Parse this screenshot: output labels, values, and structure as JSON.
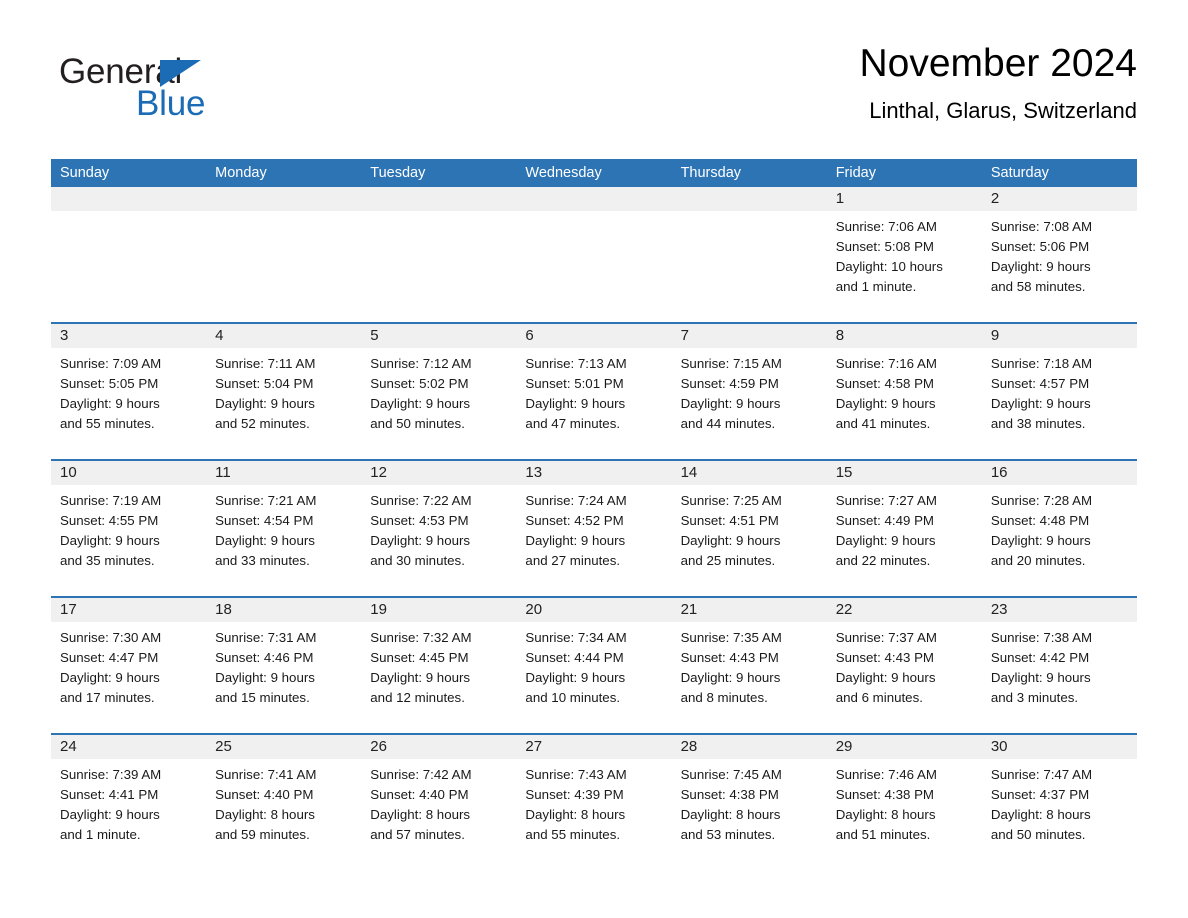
{
  "brand": {
    "name_part1": "General",
    "name_part2": "Blue",
    "logo_icon": "blue-triangle-icon",
    "accent_color": "#1b6cb5"
  },
  "header": {
    "title": "November 2024",
    "subtitle": "Linthal, Glarus, Switzerland"
  },
  "colors": {
    "header_row_bg": "#2d74b5",
    "header_row_text": "#ffffff",
    "date_band_bg": "#f0f0f0",
    "row_divider": "#2d74b5",
    "cell_text": "#1a1a1a"
  },
  "calendar": {
    "weekdays": [
      "Sunday",
      "Monday",
      "Tuesday",
      "Wednesday",
      "Thursday",
      "Friday",
      "Saturday"
    ],
    "weeks": [
      [
        {
          "date": "",
          "lines": []
        },
        {
          "date": "",
          "lines": []
        },
        {
          "date": "",
          "lines": []
        },
        {
          "date": "",
          "lines": []
        },
        {
          "date": "",
          "lines": []
        },
        {
          "date": "1",
          "lines": [
            "Sunrise: 7:06 AM",
            "Sunset: 5:08 PM",
            "Daylight: 10 hours",
            "and 1 minute."
          ]
        },
        {
          "date": "2",
          "lines": [
            "Sunrise: 7:08 AM",
            "Sunset: 5:06 PM",
            "Daylight: 9 hours",
            "and 58 minutes."
          ]
        }
      ],
      [
        {
          "date": "3",
          "lines": [
            "Sunrise: 7:09 AM",
            "Sunset: 5:05 PM",
            "Daylight: 9 hours",
            "and 55 minutes."
          ]
        },
        {
          "date": "4",
          "lines": [
            "Sunrise: 7:11 AM",
            "Sunset: 5:04 PM",
            "Daylight: 9 hours",
            "and 52 minutes."
          ]
        },
        {
          "date": "5",
          "lines": [
            "Sunrise: 7:12 AM",
            "Sunset: 5:02 PM",
            "Daylight: 9 hours",
            "and 50 minutes."
          ]
        },
        {
          "date": "6",
          "lines": [
            "Sunrise: 7:13 AM",
            "Sunset: 5:01 PM",
            "Daylight: 9 hours",
            "and 47 minutes."
          ]
        },
        {
          "date": "7",
          "lines": [
            "Sunrise: 7:15 AM",
            "Sunset: 4:59 PM",
            "Daylight: 9 hours",
            "and 44 minutes."
          ]
        },
        {
          "date": "8",
          "lines": [
            "Sunrise: 7:16 AM",
            "Sunset: 4:58 PM",
            "Daylight: 9 hours",
            "and 41 minutes."
          ]
        },
        {
          "date": "9",
          "lines": [
            "Sunrise: 7:18 AM",
            "Sunset: 4:57 PM",
            "Daylight: 9 hours",
            "and 38 minutes."
          ]
        }
      ],
      [
        {
          "date": "10",
          "lines": [
            "Sunrise: 7:19 AM",
            "Sunset: 4:55 PM",
            "Daylight: 9 hours",
            "and 35 minutes."
          ]
        },
        {
          "date": "11",
          "lines": [
            "Sunrise: 7:21 AM",
            "Sunset: 4:54 PM",
            "Daylight: 9 hours",
            "and 33 minutes."
          ]
        },
        {
          "date": "12",
          "lines": [
            "Sunrise: 7:22 AM",
            "Sunset: 4:53 PM",
            "Daylight: 9 hours",
            "and 30 minutes."
          ]
        },
        {
          "date": "13",
          "lines": [
            "Sunrise: 7:24 AM",
            "Sunset: 4:52 PM",
            "Daylight: 9 hours",
            "and 27 minutes."
          ]
        },
        {
          "date": "14",
          "lines": [
            "Sunrise: 7:25 AM",
            "Sunset: 4:51 PM",
            "Daylight: 9 hours",
            "and 25 minutes."
          ]
        },
        {
          "date": "15",
          "lines": [
            "Sunrise: 7:27 AM",
            "Sunset: 4:49 PM",
            "Daylight: 9 hours",
            "and 22 minutes."
          ]
        },
        {
          "date": "16",
          "lines": [
            "Sunrise: 7:28 AM",
            "Sunset: 4:48 PM",
            "Daylight: 9 hours",
            "and 20 minutes."
          ]
        }
      ],
      [
        {
          "date": "17",
          "lines": [
            "Sunrise: 7:30 AM",
            "Sunset: 4:47 PM",
            "Daylight: 9 hours",
            "and 17 minutes."
          ]
        },
        {
          "date": "18",
          "lines": [
            "Sunrise: 7:31 AM",
            "Sunset: 4:46 PM",
            "Daylight: 9 hours",
            "and 15 minutes."
          ]
        },
        {
          "date": "19",
          "lines": [
            "Sunrise: 7:32 AM",
            "Sunset: 4:45 PM",
            "Daylight: 9 hours",
            "and 12 minutes."
          ]
        },
        {
          "date": "20",
          "lines": [
            "Sunrise: 7:34 AM",
            "Sunset: 4:44 PM",
            "Daylight: 9 hours",
            "and 10 minutes."
          ]
        },
        {
          "date": "21",
          "lines": [
            "Sunrise: 7:35 AM",
            "Sunset: 4:43 PM",
            "Daylight: 9 hours",
            "and 8 minutes."
          ]
        },
        {
          "date": "22",
          "lines": [
            "Sunrise: 7:37 AM",
            "Sunset: 4:43 PM",
            "Daylight: 9 hours",
            "and 6 minutes."
          ]
        },
        {
          "date": "23",
          "lines": [
            "Sunrise: 7:38 AM",
            "Sunset: 4:42 PM",
            "Daylight: 9 hours",
            "and 3 minutes."
          ]
        }
      ],
      [
        {
          "date": "24",
          "lines": [
            "Sunrise: 7:39 AM",
            "Sunset: 4:41 PM",
            "Daylight: 9 hours",
            "and 1 minute."
          ]
        },
        {
          "date": "25",
          "lines": [
            "Sunrise: 7:41 AM",
            "Sunset: 4:40 PM",
            "Daylight: 8 hours",
            "and 59 minutes."
          ]
        },
        {
          "date": "26",
          "lines": [
            "Sunrise: 7:42 AM",
            "Sunset: 4:40 PM",
            "Daylight: 8 hours",
            "and 57 minutes."
          ]
        },
        {
          "date": "27",
          "lines": [
            "Sunrise: 7:43 AM",
            "Sunset: 4:39 PM",
            "Daylight: 8 hours",
            "and 55 minutes."
          ]
        },
        {
          "date": "28",
          "lines": [
            "Sunrise: 7:45 AM",
            "Sunset: 4:38 PM",
            "Daylight: 8 hours",
            "and 53 minutes."
          ]
        },
        {
          "date": "29",
          "lines": [
            "Sunrise: 7:46 AM",
            "Sunset: 4:38 PM",
            "Daylight: 8 hours",
            "and 51 minutes."
          ]
        },
        {
          "date": "30",
          "lines": [
            "Sunrise: 7:47 AM",
            "Sunset: 4:37 PM",
            "Daylight: 8 hours",
            "and 50 minutes."
          ]
        }
      ]
    ]
  }
}
